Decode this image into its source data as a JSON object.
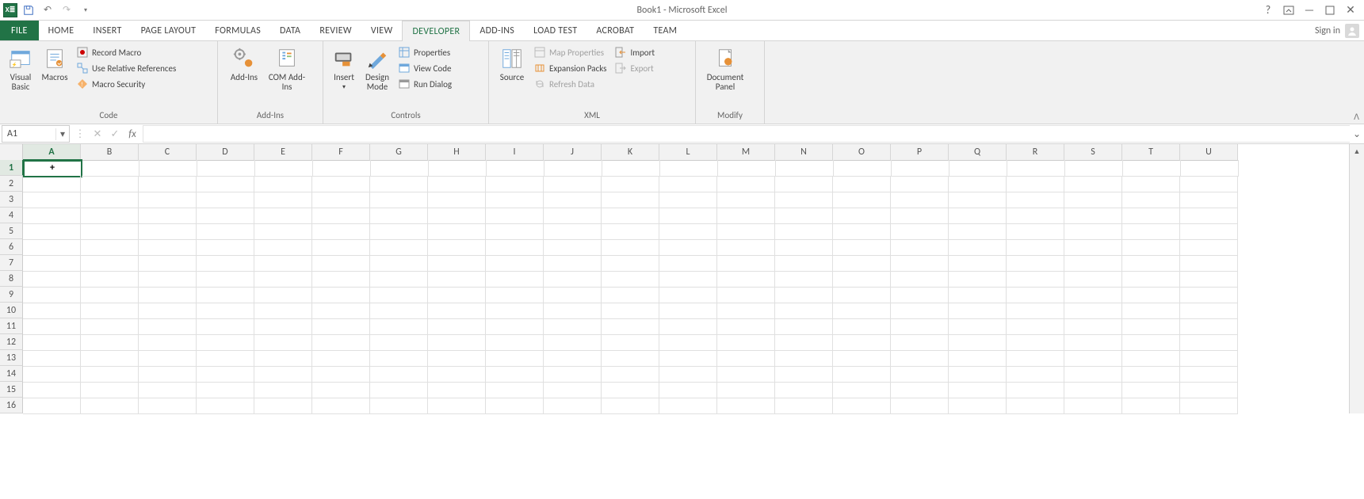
{
  "title": "Book1 - Microsoft Excel",
  "quick_access": {
    "app": "X≣"
  },
  "signin": "Sign in",
  "tabs": {
    "file": "FILE",
    "home": "HOME",
    "insert": "INSERT",
    "page_layout": "PAGE LAYOUT",
    "formulas": "FORMULAS",
    "data": "DATA",
    "review": "REVIEW",
    "view": "VIEW",
    "developer": "DEVELOPER",
    "addins": "ADD-INS",
    "loadtest": "LOAD TEST",
    "acrobat": "ACROBAT",
    "team": "TEAM"
  },
  "ribbon": {
    "code": {
      "label": "Code",
      "visual_basic": "Visual Basic",
      "macros": "Macros",
      "record": "Record Macro",
      "relative": "Use Relative References",
      "security": "Macro Security"
    },
    "addins": {
      "label": "Add-Ins",
      "addins": "Add-Ins",
      "com": "COM Add-Ins"
    },
    "controls": {
      "label": "Controls",
      "insert": "Insert",
      "design": "Design Mode",
      "properties": "Properties",
      "view_code": "View Code",
      "run_dialog": "Run Dialog"
    },
    "xml": {
      "label": "XML",
      "source": "Source",
      "map_props": "Map Properties",
      "expansion": "Expansion Packs",
      "refresh": "Refresh Data",
      "import": "Import",
      "export": "Export"
    },
    "modify": {
      "label": "Modify",
      "doc_panel": "Document Panel"
    }
  },
  "namebox": "A1",
  "active_cell_content": "+",
  "columns": [
    "A",
    "B",
    "C",
    "D",
    "E",
    "F",
    "G",
    "H",
    "I",
    "J",
    "K",
    "L",
    "M",
    "N",
    "O",
    "P",
    "Q",
    "R",
    "S",
    "T",
    "U"
  ],
  "rows": [
    "1",
    "2",
    "3",
    "4",
    "5",
    "6",
    "7",
    "8",
    "9",
    "10",
    "11",
    "12",
    "13",
    "14",
    "15",
    "16"
  ]
}
